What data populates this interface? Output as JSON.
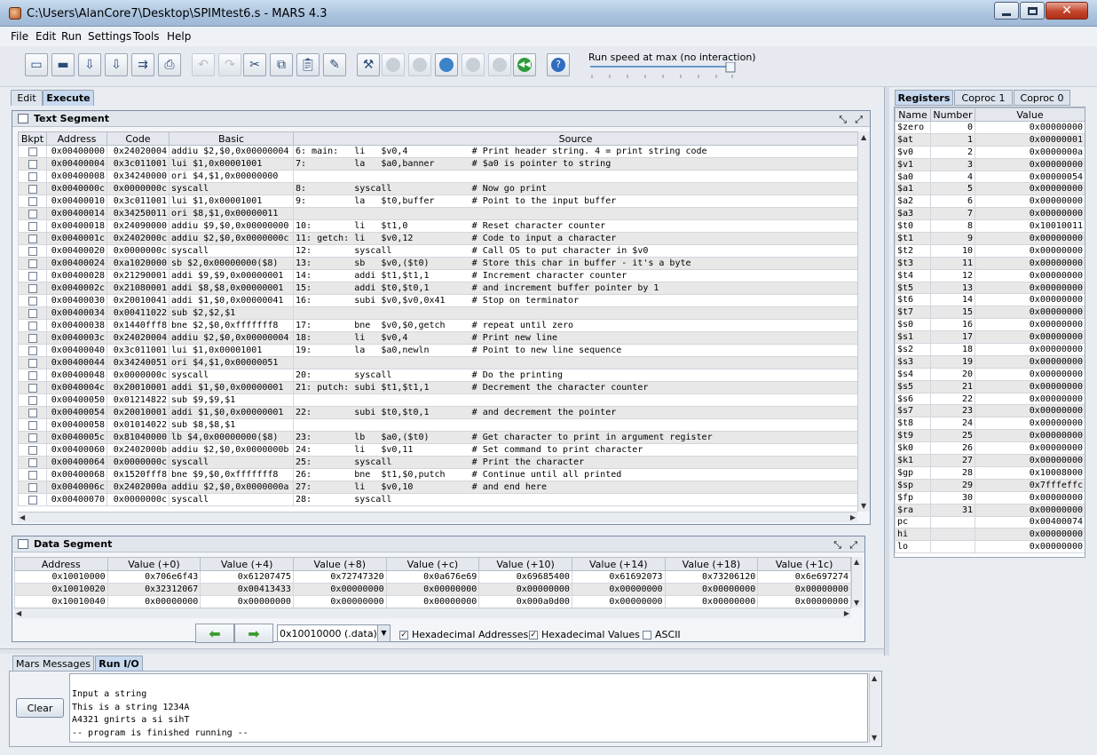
{
  "window": {
    "title": "C:\\Users\\AlanCore7\\Desktop\\SPIMtest6.s  - MARS 4.3"
  },
  "menu": [
    "File",
    "Edit",
    "Run",
    "Settings",
    "Tools",
    "Help"
  ],
  "toolbar": {
    "buttons": [
      "new-file",
      "open-file",
      "save-file",
      "save-as",
      "dump-memory",
      "print",
      "undo",
      "redo",
      "cut",
      "copy",
      "paste",
      "find-replace",
      "assemble",
      "run",
      "step",
      "backstep",
      "pause",
      "stop",
      "reset",
      "help"
    ],
    "speed_label": "Run speed at max (no interaction)",
    "speed_fraction": 1.0
  },
  "left_tabs": [
    "Edit",
    "Execute"
  ],
  "text_segment": {
    "title": "Text Segment",
    "columns": [
      "Bkpt",
      "Address",
      "Code",
      "Basic",
      "Source"
    ],
    "rows": [
      [
        "0x00400000",
        "0x24020004",
        "addiu $2,$0,0x00000004",
        "6: main:   li   $v0,4            # Print header string. 4 = print string code"
      ],
      [
        "0x00400004",
        "0x3c011001",
        "lui $1,0x00001001",
        "7:         la   $a0,banner       # $a0 is pointer to string"
      ],
      [
        "0x00400008",
        "0x34240000",
        "ori $4,$1,0x00000000",
        ""
      ],
      [
        "0x0040000c",
        "0x0000000c",
        "syscall",
        "8:         syscall               # Now go print"
      ],
      [
        "0x00400010",
        "0x3c011001",
        "lui $1,0x00001001",
        "9:         la   $t0,buffer       # Point to the input buffer"
      ],
      [
        "0x00400014",
        "0x34250011",
        "ori $8,$1,0x00000011",
        ""
      ],
      [
        "0x00400018",
        "0x24090000",
        "addiu $9,$0,0x00000000",
        "10:        li   $t1,0            # Reset character counter"
      ],
      [
        "0x0040001c",
        "0x2402000c",
        "addiu $2,$0,0x0000000c",
        "11: getch: li   $v0,12           # Code to input a character"
      ],
      [
        "0x00400020",
        "0x0000000c",
        "syscall",
        "12:        syscall               # Call OS to put character in $v0"
      ],
      [
        "0x00400024",
        "0xa1020000",
        "sb $2,0x00000000($8)",
        "13:        sb   $v0,($t0)        # Store this char in buffer - it's a byte"
      ],
      [
        "0x00400028",
        "0x21290001",
        "addi $9,$9,0x00000001",
        "14:        addi $t1,$t1,1        # Increment character counter"
      ],
      [
        "0x0040002c",
        "0x21080001",
        "addi $8,$8,0x00000001",
        "15:        addi $t0,$t0,1        # and increment buffer pointer by 1"
      ],
      [
        "0x00400030",
        "0x20010041",
        "addi $1,$0,0x00000041",
        "16:        subi $v0,$v0,0x41     # Stop on terminator"
      ],
      [
        "0x00400034",
        "0x00411022",
        "sub $2,$2,$1",
        ""
      ],
      [
        "0x00400038",
        "0x1440fff8",
        "bne $2,$0,0xfffffff8",
        "17:        bne  $v0,$0,getch     # repeat until zero"
      ],
      [
        "0x0040003c",
        "0x24020004",
        "addiu $2,$0,0x00000004",
        "18:        li   $v0,4            # Print new line"
      ],
      [
        "0x00400040",
        "0x3c011001",
        "lui $1,0x00001001",
        "19:        la   $a0,newln        # Point to new line sequence"
      ],
      [
        "0x00400044",
        "0x34240051",
        "ori $4,$1,0x00000051",
        ""
      ],
      [
        "0x00400048",
        "0x0000000c",
        "syscall",
        "20:        syscall               # Do the printing"
      ],
      [
        "0x0040004c",
        "0x20010001",
        "addi $1,$0,0x00000001",
        "21: putch: subi $t1,$t1,1        # Decrement the character counter"
      ],
      [
        "0x00400050",
        "0x01214822",
        "sub $9,$9,$1",
        ""
      ],
      [
        "0x00400054",
        "0x20010001",
        "addi $1,$0,0x00000001",
        "22:        subi $t0,$t0,1        # and decrement the pointer"
      ],
      [
        "0x00400058",
        "0x01014022",
        "sub $8,$8,$1",
        ""
      ],
      [
        "0x0040005c",
        "0x81040000",
        "lb $4,0x00000000($8)",
        "23:        lb   $a0,($t0)        # Get character to print in argument register"
      ],
      [
        "0x00400060",
        "0x2402000b",
        "addiu $2,$0,0x0000000b",
        "24:        li   $v0,11           # Set command to print character"
      ],
      [
        "0x00400064",
        "0x0000000c",
        "syscall",
        "25:        syscall               # Print the character"
      ],
      [
        "0x00400068",
        "0x1520fff8",
        "bne $9,$0,0xfffffff8",
        "26:        bne  $t1,$0,putch     # Continue until all printed"
      ],
      [
        "0x0040006c",
        "0x2402000a",
        "addiu $2,$0,0x0000000a",
        "27:        li   $v0,10           # and end here"
      ],
      [
        "0x00400070",
        "0x0000000c",
        "syscall",
        "28:        syscall"
      ]
    ]
  },
  "data_segment": {
    "title": "Data Segment",
    "columns": [
      "Address",
      "Value (+0)",
      "Value (+4)",
      "Value (+8)",
      "Value (+c)",
      "Value (+10)",
      "Value (+14)",
      "Value (+18)",
      "Value (+1c)"
    ],
    "rows": [
      [
        "0x10010000",
        "0x706e6f43",
        "0x61207475",
        "0x72747320",
        "0x0a676e69",
        "0x69685400",
        "0x61692073",
        "0x73206120",
        "0x6e697274"
      ],
      [
        "0x10010020",
        "0x32312067",
        "0x00413433",
        "0x00000000",
        "0x00000000",
        "0x00000000",
        "0x00000000",
        "0x00000000",
        "0x00000000"
      ],
      [
        "0x10010040",
        "0x00000000",
        "0x00000000",
        "0x00000000",
        "0x00000000",
        "0x000a0d00",
        "0x00000000",
        "0x00000000",
        "0x00000000"
      ]
    ],
    "address_select": "0x10010000 (.data)",
    "hex_addresses_label": "Hexadecimal Addresses",
    "hex_values_label": "Hexadecimal Values",
    "ascii_label": "ASCII",
    "hex_addresses": true,
    "hex_values": true,
    "ascii": false
  },
  "registers": {
    "tabs": [
      "Registers",
      "Coproc 1",
      "Coproc 0"
    ],
    "columns": [
      "Name",
      "Number",
      "Value"
    ],
    "rows": [
      [
        "$zero",
        "0",
        "0x00000000"
      ],
      [
        "$at",
        "1",
        "0x00000001"
      ],
      [
        "$v0",
        "2",
        "0x0000000a"
      ],
      [
        "$v1",
        "3",
        "0x00000000"
      ],
      [
        "$a0",
        "4",
        "0x00000054"
      ],
      [
        "$a1",
        "5",
        "0x00000000"
      ],
      [
        "$a2",
        "6",
        "0x00000000"
      ],
      [
        "$a3",
        "7",
        "0x00000000"
      ],
      [
        "$t0",
        "8",
        "0x10010011"
      ],
      [
        "$t1",
        "9",
        "0x00000000"
      ],
      [
        "$t2",
        "10",
        "0x00000000"
      ],
      [
        "$t3",
        "11",
        "0x00000000"
      ],
      [
        "$t4",
        "12",
        "0x00000000"
      ],
      [
        "$t5",
        "13",
        "0x00000000"
      ],
      [
        "$t6",
        "14",
        "0x00000000"
      ],
      [
        "$t7",
        "15",
        "0x00000000"
      ],
      [
        "$s0",
        "16",
        "0x00000000"
      ],
      [
        "$s1",
        "17",
        "0x00000000"
      ],
      [
        "$s2",
        "18",
        "0x00000000"
      ],
      [
        "$s3",
        "19",
        "0x00000000"
      ],
      [
        "$s4",
        "20",
        "0x00000000"
      ],
      [
        "$s5",
        "21",
        "0x00000000"
      ],
      [
        "$s6",
        "22",
        "0x00000000"
      ],
      [
        "$s7",
        "23",
        "0x00000000"
      ],
      [
        "$t8",
        "24",
        "0x00000000"
      ],
      [
        "$t9",
        "25",
        "0x00000000"
      ],
      [
        "$k0",
        "26",
        "0x00000000"
      ],
      [
        "$k1",
        "27",
        "0x00000000"
      ],
      [
        "$gp",
        "28",
        "0x10008000"
      ],
      [
        "$sp",
        "29",
        "0x7fffeffc"
      ],
      [
        "$fp",
        "30",
        "0x00000000"
      ],
      [
        "$ra",
        "31",
        "0x00000000"
      ],
      [
        "pc",
        "",
        "0x00400074"
      ],
      [
        "hi",
        "",
        "0x00000000"
      ],
      [
        "lo",
        "",
        "0x00000000"
      ]
    ]
  },
  "messages": {
    "tabs": [
      "Mars Messages",
      "Run I/O"
    ],
    "clear_label": "Clear",
    "lines": [
      "Input a string",
      "This is a string 1234A",
      "A4321 gnirts a si sihT",
      "-- program is finished running --"
    ]
  }
}
